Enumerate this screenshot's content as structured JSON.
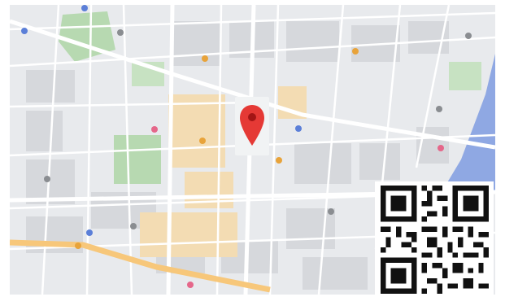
{
  "map": {
    "type": "street-map",
    "colors": {
      "land": "#e8eaed",
      "block": "#d6d8dc",
      "road_minor": "#ffffff",
      "road_major": "#f7c77a",
      "park": "#b7d9b1",
      "water": "#8fa8e3",
      "pin": "#e53935",
      "pin_bg": "#f1f3f4",
      "poi_blue": "#5b7fd8",
      "poi_orange": "#e8a33a",
      "poi_pink": "#e5678a",
      "poi_gray": "#8a8d91"
    },
    "marker": {
      "icon": "map-pin-icon"
    },
    "labels_note": ""
  },
  "qr": {
    "icon": "qr-code-icon",
    "dark": "#111111",
    "light": "#ffffff"
  }
}
